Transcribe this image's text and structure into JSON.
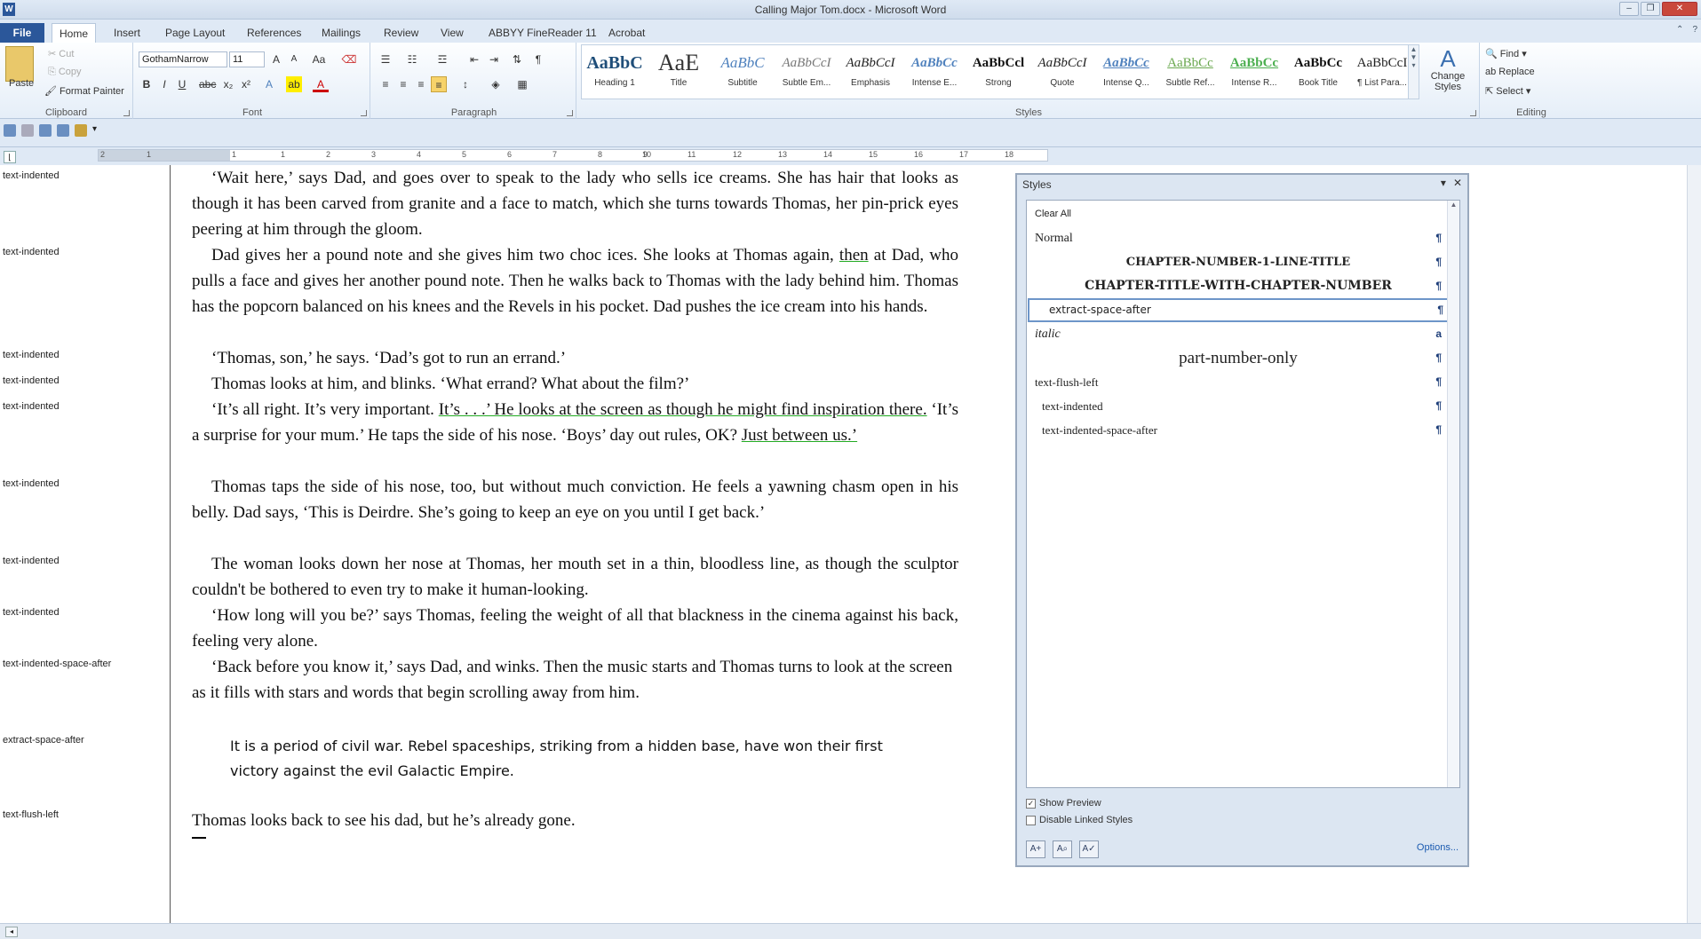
{
  "window": {
    "title": "Calling Major Tom.docx - Microsoft Word"
  },
  "tabs": [
    {
      "label": "File"
    },
    {
      "label": "Home"
    },
    {
      "label": "Insert"
    },
    {
      "label": "Page Layout"
    },
    {
      "label": "References"
    },
    {
      "label": "Mailings"
    },
    {
      "label": "Review"
    },
    {
      "label": "View"
    },
    {
      "label": "ABBYY FineReader 11"
    },
    {
      "label": "Acrobat"
    }
  ],
  "clipboard": {
    "paste": "Paste",
    "cut": "Cut",
    "copy": "Copy",
    "format_painter": "Format Painter",
    "label": "Clipboard"
  },
  "font": {
    "name": "GothamNarrow",
    "size": "11",
    "label": "Font"
  },
  "paragraph": {
    "label": "Paragraph"
  },
  "styles_group": {
    "label": "Styles",
    "change_styles": "Change Styles"
  },
  "gallery": [
    {
      "preview": "AaBbC",
      "label": "Heading 1",
      "color": "#1f4e79"
    },
    {
      "preview": "AaE",
      "label": "Title",
      "color": "#333333"
    },
    {
      "preview": "AaBbC",
      "label": "Subtitle",
      "color": "#4f81bd"
    },
    {
      "preview": "AaBbCcI",
      "label": "Subtle Em...",
      "color": "#777777"
    },
    {
      "preview": "AaBbCcI",
      "label": "Emphasis",
      "color": "#222222"
    },
    {
      "preview": "AaBbCc",
      "label": "Intense E...",
      "color": "#4f81bd"
    },
    {
      "preview": "AaBbCcl",
      "label": "Strong",
      "color": "#111111"
    },
    {
      "preview": "AaBbCcI",
      "label": "Quote",
      "color": "#222222"
    },
    {
      "preview": "AaBbCc",
      "label": "Intense Q...",
      "color": "#4f81bd"
    },
    {
      "preview": "AaBbCc",
      "label": "Subtle Ref...",
      "color": "#6aa84f"
    },
    {
      "preview": "AaBbCc",
      "label": "Intense R...",
      "color": "#4caf50"
    },
    {
      "preview": "AaBbCc",
      "label": "Book Title",
      "color": "#111111"
    },
    {
      "preview": "AaBbCcI",
      "label": "¶ List Para...",
      "color": "#222222"
    }
  ],
  "editing": {
    "find": "Find",
    "replace": "Replace",
    "select": "Select",
    "label": "Editing"
  },
  "ruler": {
    "marks": [
      "2",
      "1",
      "1",
      "1",
      "2",
      "3",
      "4",
      "5",
      "6",
      "7",
      "8",
      "9",
      "10",
      "11",
      "12",
      "13",
      "14",
      "15",
      "16",
      "17",
      "18"
    ]
  },
  "style_area": [
    {
      "label": "text-indented"
    },
    {
      "label": "text-indented"
    },
    {
      "label": "text-indented"
    },
    {
      "label": "text-indented"
    },
    {
      "label": "text-indented"
    },
    {
      "label": "text-indented"
    },
    {
      "label": "text-indented"
    },
    {
      "label": "text-indented"
    },
    {
      "label": "text-indented-space-after"
    },
    {
      "label": "extract-space-after"
    },
    {
      "label": "text-flush-left"
    }
  ],
  "document": {
    "p1": "‘Wait here,’ says Dad, and goes over to speak to the lady who sells ice creams. She has hair that looks as though it has been carved from granite and a face to match, which she turns towards Thomas, her pin-prick eyes peering at him through the gloom.",
    "p2a": "Dad gives her a pound note and she gives him two choc ices. She looks at Thomas again, ",
    "p2b": "then",
    "p2c": " at Dad, who pulls a face and gives her another pound note. Then he walks back to Thomas with the lady behind him. Thomas has the popcorn balanced on his knees and the Revels in his pocket. Dad pushes the ice cream into his hands.",
    "p3": "‘Thomas, son,’ he says. ‘Dad’s got to run an errand.’",
    "p4": "Thomas looks at him, and blinks. ‘What errand? What about the film?’",
    "p5a": "‘It’s all right. It’s very important. ",
    "p5b": "It’s . . .’ He looks at the screen as though he might find inspiration there.",
    "p5c": " ‘It’s a surprise for your mum.’ He taps the side of his nose. ‘Boys’ day out rules, OK? ",
    "p5d": "Just between us.’",
    "p6": "Thomas taps the side of his nose, too, but without much conviction. He feels a yawning chasm open in his belly. Dad says, ‘This is Deirdre. She’s going to keep an eye on you until I get back.’",
    "p7": "The woman looks down her nose at Thomas, her mouth set in a thin, bloodless line, as though the sculptor couldn't be bothered to even try to make it human-looking.",
    "p8": "‘How long will you be?’ says Thomas, feeling the weight of all that blackness in the cinema against his back, feeling very alone.",
    "p9": "‘Back before you know it,’ says Dad, and winks. Then the music starts and Thomas turns to look at the screen as it fills with stars and words that begin scrolling away from him.",
    "extract": "It is a period of civil war. Rebel spaceships, striking from a hidden base, have won their first victory against the evil Galactic Empire.",
    "p10": "Thomas looks back to see his dad, but he’s already gone."
  },
  "styles_pane": {
    "title": "Styles",
    "items": [
      {
        "label": "Clear All",
        "mark": ""
      },
      {
        "label": "Normal",
        "mark": "¶"
      },
      {
        "label": "CHAPTER-NUMBER-1-LINE-TITLE",
        "mark": "¶"
      },
      {
        "label": "CHAPTER-TITLE-WITH-CHAPTER-NUMBER",
        "mark": "¶"
      },
      {
        "label": "extract-space-after",
        "mark": "¶"
      },
      {
        "label": "italic",
        "mark": "a"
      },
      {
        "label": "part-number-only",
        "mark": "¶"
      },
      {
        "label": "text-flush-left",
        "mark": "¶"
      },
      {
        "label": "text-indented",
        "mark": "¶"
      },
      {
        "label": "text-indented-space-after",
        "mark": "¶"
      }
    ],
    "show_preview": "Show Preview",
    "disable_linked": "Disable Linked Styles",
    "options": "Options..."
  }
}
